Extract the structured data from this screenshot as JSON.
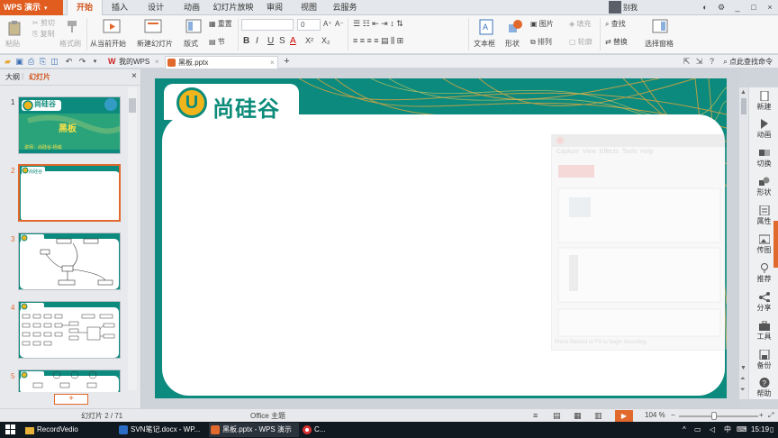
{
  "app": {
    "name": "WPS 演示",
    "window_controls": [
      "_",
      "□",
      "×"
    ],
    "user_name": "别我"
  },
  "menu_tabs": [
    "开始",
    "插入",
    "设计",
    "动画",
    "幻灯片放映",
    "审阅",
    "视图",
    "云服务"
  ],
  "active_menu_tab": "开始",
  "ribbon": {
    "paste": "粘贴",
    "cut": "剪切",
    "copy": "复制",
    "format_painter": "格式刷",
    "from_current": "从当前开始",
    "new_slide": "新建幻灯片",
    "layout": "版式",
    "reset": "重置",
    "section": "节",
    "font_size": "0",
    "textbox": "文本框",
    "shape": "形状",
    "picture": "图片",
    "fill": "填充",
    "arrange": "排列",
    "outline": "轮廓",
    "find": "查找",
    "replace": "替换",
    "select_pane": "选择窗格",
    "format_buttons": [
      "B",
      "I",
      "U",
      "S",
      "A",
      "X²",
      "X₂"
    ]
  },
  "doc_tabs": [
    {
      "label": "我的WPS",
      "icon": "wps-home-icon"
    },
    {
      "label": "黑板.pptx",
      "icon": "ppt-file-icon"
    }
  ],
  "find_command": "点此查找命令",
  "left_pane": {
    "tabs": [
      "大纲",
      "幻灯片"
    ],
    "active_tab": "幻灯片",
    "slide_numbers": [
      "1",
      "2",
      "3",
      "4",
      "5"
    ],
    "thumb1_logo": "尚硅谷",
    "thumb1_title": "黑板",
    "thumb1_sub": "讲师：尚硅谷-杨威",
    "add_button": "+"
  },
  "slide": {
    "logo_letter": "U",
    "logo_text": "尚硅谷",
    "ghost_menu": [
      "Capture",
      "View",
      "Effects",
      "Tools",
      "Help"
    ],
    "ghost_footer": "Press Record or F9 to begin recording"
  },
  "right_rail": [
    "新建",
    "动画",
    "切换",
    "形状",
    "属性",
    "传图",
    "推荐",
    "分享",
    "工具",
    "备份",
    "帮助"
  ],
  "status": {
    "slide_pos": "幻灯片 2 / 71",
    "theme": "Office 主题",
    "zoom": "104 %",
    "zoom_fraction": 0.44
  },
  "taskbar": {
    "items": [
      {
        "label": "RecordVedio",
        "icon": "folder-icon",
        "color": "#e8b23a"
      },
      {
        "label": "SVN笔记.docx - WP...",
        "icon": "word-icon",
        "color": "#2b6cc4"
      },
      {
        "label": "黑板.pptx - WPS 演示",
        "icon": "ppt-icon",
        "color": "#e1692d"
      },
      {
        "label": "C...",
        "icon": "chrome-icon",
        "color": "#d33"
      }
    ],
    "ime": "中",
    "time": "15:19"
  },
  "colors": {
    "accent": "#e1692d",
    "slide_teal": "#0b8a7d",
    "logo_yellow": "#f0b51d"
  }
}
